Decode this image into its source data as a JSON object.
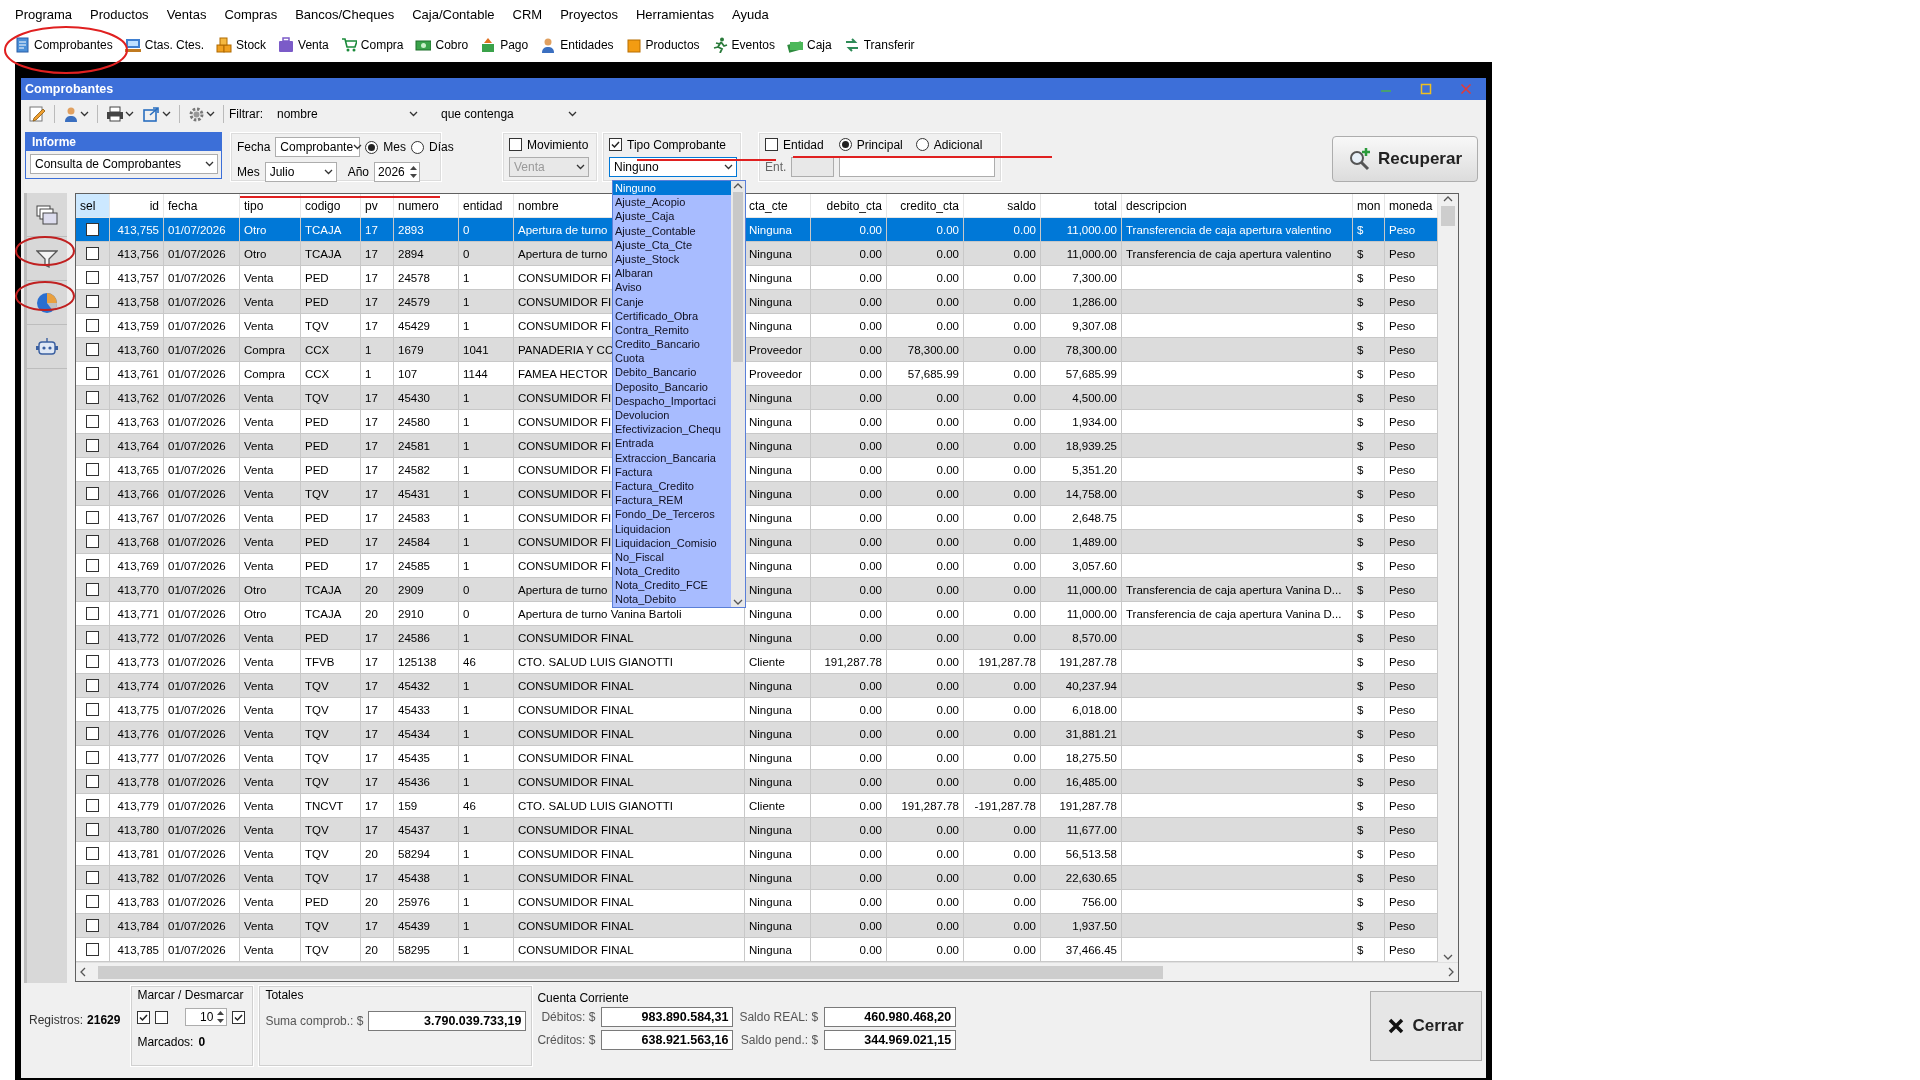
{
  "menu": [
    "Programa",
    "Productos",
    "Ventas",
    "Compras",
    "Bancos/Cheques",
    "Caja/Contable",
    "CRM",
    "Proyectos",
    "Herramientas",
    "Ayuda"
  ],
  "toolbar": [
    "Comprobantes",
    "Ctas. Ctes.",
    "Stock",
    "Venta",
    "Compra",
    "Cobro",
    "Pago",
    "Entidades",
    "Productos",
    "Eventos",
    "Caja",
    "Transferir"
  ],
  "window": {
    "title": "Comprobantes"
  },
  "filter": {
    "label": "Filtrar:",
    "field": "nombre",
    "condition": "que contenga"
  },
  "informe": {
    "title": "Informe",
    "value": "Consulta de Comprobantes"
  },
  "fecha": {
    "label": "Fecha",
    "select": "Comprobante",
    "modes": [
      {
        "label": "Mes",
        "selected": true
      },
      {
        "label": "Días",
        "selected": false
      }
    ],
    "mes_label": "Mes",
    "mes": "Julio",
    "anio_label": "Año",
    "anio": "2026"
  },
  "movimiento": {
    "label": "Movimiento",
    "checked": false,
    "value": "Venta",
    "disabled": true
  },
  "tipo_comprobante": {
    "label": "Tipo Comprobante",
    "checked": true,
    "value": "Ninguno",
    "options": [
      {
        "label": "Ninguno",
        "selected": true
      },
      {
        "label": "Ajuste_Acopio",
        "selected": false
      },
      {
        "label": "Ajuste_Caja",
        "selected": false
      },
      {
        "label": "Ajuste_Contable",
        "selected": false
      },
      {
        "label": "Ajuste_Cta_Cte",
        "selected": false
      },
      {
        "label": "Ajuste_Stock",
        "selected": false
      },
      {
        "label": "Albaran",
        "selected": false
      },
      {
        "label": "Aviso",
        "selected": false
      },
      {
        "label": "Canje",
        "selected": false
      },
      {
        "label": "Certificado_Obra",
        "selected": false
      },
      {
        "label": "Contra_Remito",
        "selected": false
      },
      {
        "label": "Credito_Bancario",
        "selected": false
      },
      {
        "label": "Cuota",
        "selected": false
      },
      {
        "label": "Debito_Bancario",
        "selected": false
      },
      {
        "label": "Deposito_Bancario",
        "selected": false
      },
      {
        "label": "Despacho_Importaci",
        "selected": false
      },
      {
        "label": "Devolucion",
        "selected": false
      },
      {
        "label": "Efectivizacion_Chequ",
        "selected": false
      },
      {
        "label": "Entrada",
        "selected": false
      },
      {
        "label": "Extraccion_Bancaria",
        "selected": false
      },
      {
        "label": "Factura",
        "selected": false
      },
      {
        "label": "Factura_Credito",
        "selected": false
      },
      {
        "label": "Factura_REM",
        "selected": false
      },
      {
        "label": "Fondo_De_Terceros",
        "selected": false
      },
      {
        "label": "Liquidacion",
        "selected": false
      },
      {
        "label": "Liquidacion_Comisio",
        "selected": false
      },
      {
        "label": "No_Fiscal",
        "selected": false
      },
      {
        "label": "Nota_Credito",
        "selected": false
      },
      {
        "label": "Nota_Credito_FCE",
        "selected": false
      },
      {
        "label": "Nota_Debito",
        "selected": false
      }
    ]
  },
  "entidad": {
    "label": "Entidad",
    "checked": false,
    "modes": [
      {
        "label": "Principal",
        "selected": true
      },
      {
        "label": "Adicional",
        "selected": false
      }
    ],
    "ent_label": "Ent."
  },
  "recuperar_button": "Recuperar",
  "table": {
    "columns": [
      "sel",
      "id",
      "fecha",
      "tipo",
      "codigo",
      "pv",
      "numero",
      "entidad",
      "nombre",
      "cta_cte",
      "debito_cta",
      "credito_cta",
      "saldo",
      "total",
      "descripcion",
      "mon",
      "moneda"
    ],
    "rows": [
      {
        "selected": true,
        "checked": false,
        "id": "413,755",
        "fecha": "01/07/2026",
        "tipo": "Otro",
        "codigo": "TCAJA",
        "pv": "17",
        "numero": "2893",
        "entidad": "0",
        "nombre": "Apertura de turno",
        "cta_cte": "Ninguna",
        "debito_cta": "0.00",
        "credito_cta": "0.00",
        "saldo": "0.00",
        "total": "11,000.00",
        "descripcion": "Transferencia de caja apertura valentino",
        "mon": "$",
        "moneda": "Peso"
      },
      {
        "selected": false,
        "checked": false,
        "id": "413,756",
        "fecha": "01/07/2026",
        "tipo": "Otro",
        "codigo": "TCAJA",
        "pv": "17",
        "numero": "2894",
        "entidad": "0",
        "nombre": "Apertura de turno",
        "cta_cte": "Ninguna",
        "debito_cta": "0.00",
        "credito_cta": "0.00",
        "saldo": "0.00",
        "total": "11,000.00",
        "descripcion": "Transferencia de caja apertura valentino",
        "mon": "$",
        "moneda": "Peso"
      },
      {
        "selected": false,
        "checked": false,
        "id": "413,757",
        "fecha": "01/07/2026",
        "tipo": "Venta",
        "codigo": "PED",
        "pv": "17",
        "numero": "24578",
        "entidad": "1",
        "nombre": "CONSUMIDOR FI",
        "cta_cte": "Ninguna",
        "debito_cta": "0.00",
        "credito_cta": "0.00",
        "saldo": "0.00",
        "total": "7,300.00",
        "mon": "$",
        "moneda": "Peso"
      },
      {
        "selected": false,
        "checked": false,
        "id": "413,758",
        "fecha": "01/07/2026",
        "tipo": "Venta",
        "codigo": "PED",
        "pv": "17",
        "numero": "24579",
        "entidad": "1",
        "nombre": "CONSUMIDOR FI",
        "cta_cte": "Ninguna",
        "debito_cta": "0.00",
        "credito_cta": "0.00",
        "saldo": "0.00",
        "total": "1,286.00",
        "mon": "$",
        "moneda": "Peso"
      },
      {
        "selected": false,
        "checked": false,
        "id": "413,759",
        "fecha": "01/07/2026",
        "tipo": "Venta",
        "codigo": "TQV",
        "pv": "17",
        "numero": "45429",
        "entidad": "1",
        "nombre": "CONSUMIDOR FI",
        "cta_cte": "Ninguna",
        "debito_cta": "0.00",
        "credito_cta": "0.00",
        "saldo": "0.00",
        "total": "9,307.08",
        "mon": "$",
        "moneda": "Peso"
      },
      {
        "selected": false,
        "checked": false,
        "id": "413,760",
        "fecha": "01/07/2026",
        "tipo": "Compra",
        "codigo": "CCX",
        "pv": "1",
        "numero": "1679",
        "entidad": "1041",
        "nombre": "PANADERIA Y CO",
        "cta_cte": "Proveedor",
        "debito_cta": "0.00",
        "credito_cta": "78,300.00",
        "saldo": "0.00",
        "total": "78,300.00",
        "mon": "$",
        "moneda": "Peso"
      },
      {
        "selected": false,
        "checked": false,
        "id": "413,761",
        "fecha": "01/07/2026",
        "tipo": "Compra",
        "codigo": "CCX",
        "pv": "1",
        "numero": "107",
        "entidad": "1144",
        "nombre": "FAMEA HECTOR",
        "cta_cte": "Proveedor",
        "debito_cta": "0.00",
        "credito_cta": "57,685.99",
        "saldo": "0.00",
        "total": "57,685.99",
        "mon": "$",
        "moneda": "Peso"
      },
      {
        "selected": false,
        "checked": false,
        "id": "413,762",
        "fecha": "01/07/2026",
        "tipo": "Venta",
        "codigo": "TQV",
        "pv": "17",
        "numero": "45430",
        "entidad": "1",
        "nombre": "CONSUMIDOR FI",
        "cta_cte": "Ninguna",
        "debito_cta": "0.00",
        "credito_cta": "0.00",
        "saldo": "0.00",
        "total": "4,500.00",
        "mon": "$",
        "moneda": "Peso"
      },
      {
        "selected": false,
        "checked": false,
        "id": "413,763",
        "fecha": "01/07/2026",
        "tipo": "Venta",
        "codigo": "PED",
        "pv": "17",
        "numero": "24580",
        "entidad": "1",
        "nombre": "CONSUMIDOR FI",
        "cta_cte": "Ninguna",
        "debito_cta": "0.00",
        "credito_cta": "0.00",
        "saldo": "0.00",
        "total": "1,934.00",
        "mon": "$",
        "moneda": "Peso"
      },
      {
        "selected": false,
        "checked": false,
        "id": "413,764",
        "fecha": "01/07/2026",
        "tipo": "Venta",
        "codigo": "PED",
        "pv": "17",
        "numero": "24581",
        "entidad": "1",
        "nombre": "CONSUMIDOR FI",
        "cta_cte": "Ninguna",
        "debito_cta": "0.00",
        "credito_cta": "0.00",
        "saldo": "0.00",
        "total": "18,939.25",
        "mon": "$",
        "moneda": "Peso"
      },
      {
        "selected": false,
        "checked": false,
        "id": "413,765",
        "fecha": "01/07/2026",
        "tipo": "Venta",
        "codigo": "PED",
        "pv": "17",
        "numero": "24582",
        "entidad": "1",
        "nombre": "CONSUMIDOR FI",
        "cta_cte": "Ninguna",
        "debito_cta": "0.00",
        "credito_cta": "0.00",
        "saldo": "0.00",
        "total": "5,351.20",
        "mon": "$",
        "moneda": "Peso"
      },
      {
        "selected": false,
        "checked": false,
        "id": "413,766",
        "fecha": "01/07/2026",
        "tipo": "Venta",
        "codigo": "TQV",
        "pv": "17",
        "numero": "45431",
        "entidad": "1",
        "nombre": "CONSUMIDOR FI",
        "cta_cte": "Ninguna",
        "debito_cta": "0.00",
        "credito_cta": "0.00",
        "saldo": "0.00",
        "total": "14,758.00",
        "mon": "$",
        "moneda": "Peso"
      },
      {
        "selected": false,
        "checked": false,
        "id": "413,767",
        "fecha": "01/07/2026",
        "tipo": "Venta",
        "codigo": "PED",
        "pv": "17",
        "numero": "24583",
        "entidad": "1",
        "nombre": "CONSUMIDOR FI",
        "cta_cte": "Ninguna",
        "debito_cta": "0.00",
        "credito_cta": "0.00",
        "saldo": "0.00",
        "total": "2,648.75",
        "mon": "$",
        "moneda": "Peso"
      },
      {
        "selected": false,
        "checked": false,
        "id": "413,768",
        "fecha": "01/07/2026",
        "tipo": "Venta",
        "codigo": "PED",
        "pv": "17",
        "numero": "24584",
        "entidad": "1",
        "nombre": "CONSUMIDOR FI",
        "cta_cte": "Ninguna",
        "debito_cta": "0.00",
        "credito_cta": "0.00",
        "saldo": "0.00",
        "total": "1,489.00",
        "mon": "$",
        "moneda": "Peso"
      },
      {
        "selected": false,
        "checked": false,
        "id": "413,769",
        "fecha": "01/07/2026",
        "tipo": "Venta",
        "codigo": "PED",
        "pv": "17",
        "numero": "24585",
        "entidad": "1",
        "nombre": "CONSUMIDOR FI",
        "cta_cte": "Ninguna",
        "debito_cta": "0.00",
        "credito_cta": "0.00",
        "saldo": "0.00",
        "total": "3,057.60",
        "mon": "$",
        "moneda": "Peso"
      },
      {
        "selected": false,
        "checked": false,
        "id": "413,770",
        "fecha": "01/07/2026",
        "tipo": "Otro",
        "codigo": "TCAJA",
        "pv": "20",
        "numero": "2909",
        "entidad": "0",
        "nombre": "Apertura de turno",
        "cta_cte": "Ninguna",
        "debito_cta": "0.00",
        "credito_cta": "0.00",
        "saldo": "0.00",
        "total": "11,000.00",
        "descripcion": "Transferencia de caja apertura Vanina D...",
        "mon": "$",
        "moneda": "Peso"
      },
      {
        "selected": false,
        "checked": false,
        "id": "413,771",
        "fecha": "01/07/2026",
        "tipo": "Otro",
        "codigo": "TCAJA",
        "pv": "20",
        "numero": "2910",
        "entidad": "0",
        "nombre": "Apertura de turno Vanina Bartoli",
        "cta_cte": "Ninguna",
        "debito_cta": "0.00",
        "credito_cta": "0.00",
        "saldo": "0.00",
        "total": "11,000.00",
        "descripcion": "Transferencia de caja apertura Vanina D...",
        "mon": "$",
        "moneda": "Peso"
      },
      {
        "selected": false,
        "checked": false,
        "id": "413,772",
        "fecha": "01/07/2026",
        "tipo": "Venta",
        "codigo": "PED",
        "pv": "17",
        "numero": "24586",
        "entidad": "1",
        "nombre": "CONSUMIDOR FINAL",
        "cta_cte": "Ninguna",
        "debito_cta": "0.00",
        "credito_cta": "0.00",
        "saldo": "0.00",
        "total": "8,570.00",
        "mon": "$",
        "moneda": "Peso"
      },
      {
        "selected": false,
        "checked": false,
        "id": "413,773",
        "fecha": "01/07/2026",
        "tipo": "Venta",
        "codigo": "TFVB",
        "pv": "17",
        "numero": "125138",
        "entidad": "46",
        "nombre": "CTO. SALUD LUIS GIANOTTI",
        "cta_cte": "Cliente",
        "debito_cta": "191,287.78",
        "credito_cta": "0.00",
        "saldo": "191,287.78",
        "total": "191,287.78",
        "mon": "$",
        "moneda": "Peso"
      },
      {
        "selected": false,
        "checked": false,
        "id": "413,774",
        "fecha": "01/07/2026",
        "tipo": "Venta",
        "codigo": "TQV",
        "pv": "17",
        "numero": "45432",
        "entidad": "1",
        "nombre": "CONSUMIDOR FINAL",
        "cta_cte": "Ninguna",
        "debito_cta": "0.00",
        "credito_cta": "0.00",
        "saldo": "0.00",
        "total": "40,237.94",
        "mon": "$",
        "moneda": "Peso"
      },
      {
        "selected": false,
        "checked": false,
        "id": "413,775",
        "fecha": "01/07/2026",
        "tipo": "Venta",
        "codigo": "TQV",
        "pv": "17",
        "numero": "45433",
        "entidad": "1",
        "nombre": "CONSUMIDOR FINAL",
        "cta_cte": "Ninguna",
        "debito_cta": "0.00",
        "credito_cta": "0.00",
        "saldo": "0.00",
        "total": "6,018.00",
        "mon": "$",
        "moneda": "Peso"
      },
      {
        "selected": false,
        "checked": false,
        "id": "413,776",
        "fecha": "01/07/2026",
        "tipo": "Venta",
        "codigo": "TQV",
        "pv": "17",
        "numero": "45434",
        "entidad": "1",
        "nombre": "CONSUMIDOR FINAL",
        "cta_cte": "Ninguna",
        "debito_cta": "0.00",
        "credito_cta": "0.00",
        "saldo": "0.00",
        "total": "31,881.21",
        "mon": "$",
        "moneda": "Peso"
      },
      {
        "selected": false,
        "checked": false,
        "id": "413,777",
        "fecha": "01/07/2026",
        "tipo": "Venta",
        "codigo": "TQV",
        "pv": "17",
        "numero": "45435",
        "entidad": "1",
        "nombre": "CONSUMIDOR FINAL",
        "cta_cte": "Ninguna",
        "debito_cta": "0.00",
        "credito_cta": "0.00",
        "saldo": "0.00",
        "total": "18,275.50",
        "mon": "$",
        "moneda": "Peso"
      },
      {
        "selected": false,
        "checked": false,
        "id": "413,778",
        "fecha": "01/07/2026",
        "tipo": "Venta",
        "codigo": "TQV",
        "pv": "17",
        "numero": "45436",
        "entidad": "1",
        "nombre": "CONSUMIDOR FINAL",
        "cta_cte": "Ninguna",
        "debito_cta": "0.00",
        "credito_cta": "0.00",
        "saldo": "0.00",
        "total": "16,485.00",
        "mon": "$",
        "moneda": "Peso"
      },
      {
        "selected": false,
        "checked": false,
        "id": "413,779",
        "fecha": "01/07/2026",
        "tipo": "Venta",
        "codigo": "TNCVT",
        "pv": "17",
        "numero": "159",
        "entidad": "46",
        "nombre": "CTO. SALUD LUIS GIANOTTI",
        "cta_cte": "Cliente",
        "debito_cta": "0.00",
        "credito_cta": "191,287.78",
        "saldo": "-191,287.78",
        "total": "191,287.78",
        "mon": "$",
        "moneda": "Peso"
      },
      {
        "selected": false,
        "checked": false,
        "id": "413,780",
        "fecha": "01/07/2026",
        "tipo": "Venta",
        "codigo": "TQV",
        "pv": "17",
        "numero": "45437",
        "entidad": "1",
        "nombre": "CONSUMIDOR FINAL",
        "cta_cte": "Ninguna",
        "debito_cta": "0.00",
        "credito_cta": "0.00",
        "saldo": "0.00",
        "total": "11,677.00",
        "mon": "$",
        "moneda": "Peso"
      },
      {
        "selected": false,
        "checked": false,
        "id": "413,781",
        "fecha": "01/07/2026",
        "tipo": "Venta",
        "codigo": "TQV",
        "pv": "20",
        "numero": "58294",
        "entidad": "1",
        "nombre": "CONSUMIDOR FINAL",
        "cta_cte": "Ninguna",
        "debito_cta": "0.00",
        "credito_cta": "0.00",
        "saldo": "0.00",
        "total": "56,513.58",
        "mon": "$",
        "moneda": "Peso"
      },
      {
        "selected": false,
        "checked": false,
        "id": "413,782",
        "fecha": "01/07/2026",
        "tipo": "Venta",
        "codigo": "TQV",
        "pv": "17",
        "numero": "45438",
        "entidad": "1",
        "nombre": "CONSUMIDOR FINAL",
        "cta_cte": "Ninguna",
        "debito_cta": "0.00",
        "credito_cta": "0.00",
        "saldo": "0.00",
        "total": "22,630.65",
        "mon": "$",
        "moneda": "Peso"
      },
      {
        "selected": false,
        "checked": false,
        "id": "413,783",
        "fecha": "01/07/2026",
        "tipo": "Venta",
        "codigo": "PED",
        "pv": "20",
        "numero": "25976",
        "entidad": "1",
        "nombre": "CONSUMIDOR FINAL",
        "cta_cte": "Ninguna",
        "debito_cta": "0.00",
        "credito_cta": "0.00",
        "saldo": "0.00",
        "total": "756.00",
        "mon": "$",
        "moneda": "Peso"
      },
      {
        "selected": false,
        "checked": false,
        "id": "413,784",
        "fecha": "01/07/2026",
        "tipo": "Venta",
        "codigo": "TQV",
        "pv": "17",
        "numero": "45439",
        "entidad": "1",
        "nombre": "CONSUMIDOR FINAL",
        "cta_cte": "Ninguna",
        "debito_cta": "0.00",
        "credito_cta": "0.00",
        "saldo": "0.00",
        "total": "1,937.50",
        "mon": "$",
        "moneda": "Peso"
      },
      {
        "selected": false,
        "checked": false,
        "id": "413,785",
        "fecha": "01/07/2026",
        "tipo": "Venta",
        "codigo": "TQV",
        "pv": "20",
        "numero": "58295",
        "entidad": "1",
        "nombre": "CONSUMIDOR FINAL",
        "cta_cte": "Ninguna",
        "debito_cta": "0.00",
        "credito_cta": "0.00",
        "saldo": "0.00",
        "total": "37,466.45",
        "mon": "$",
        "moneda": "Peso"
      }
    ]
  },
  "footer": {
    "registros_label": "Registros:",
    "registros": "21629",
    "marcar": {
      "title": "Marcar / Desmarcar",
      "toggles": [
        {
          "checked": true
        },
        {
          "checked": false
        },
        {
          "checked": true
        }
      ],
      "step": "10",
      "marcados_label": "Marcados:",
      "marcados": "0"
    },
    "totales": {
      "title": "Totales",
      "label": "Suma comprob.: $",
      "value": "3.790.039.733,19"
    },
    "cuenta_corriente": {
      "title": "Cuenta Corriente",
      "items": [
        {
          "label": "Débitos: $",
          "value": "983.890.584,31"
        },
        {
          "label": "Saldo REAL: $",
          "value": "460.980.468,20"
        },
        {
          "label": "Créditos: $",
          "value": "638.921.563,16"
        },
        {
          "label": "Saldo pend.: $",
          "value": "344.969.021,15"
        }
      ]
    },
    "close_button": "Cerrar"
  }
}
